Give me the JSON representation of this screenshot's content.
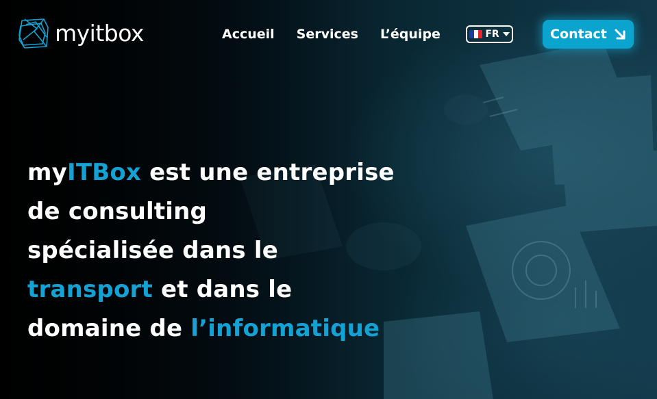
{
  "brand": {
    "logo_text": "myitbox",
    "accent_color": "#13a2d3",
    "logo_icon": "cube-outline-icon"
  },
  "nav": {
    "links": [
      "Accueil",
      "Services",
      "L’équipe"
    ],
    "language": {
      "code": "FR",
      "flag_icon": "france-flag-icon",
      "dropdown_icon": "caret-down-icon"
    },
    "cta": {
      "label": "Contact",
      "icon": "arrow-down-right-icon",
      "color": "#0aa4cf"
    }
  },
  "hero": {
    "headline": {
      "p1_accent": "my",
      "p2_accent": "ITBox",
      "p3": " est une entreprise",
      "p4": "de consulting",
      "p5": "spécialisée dans le",
      "p6_accent": "transport",
      "p7": " et dans le",
      "p8": "domaine de ",
      "p9_accent": "l’informatique"
    }
  }
}
